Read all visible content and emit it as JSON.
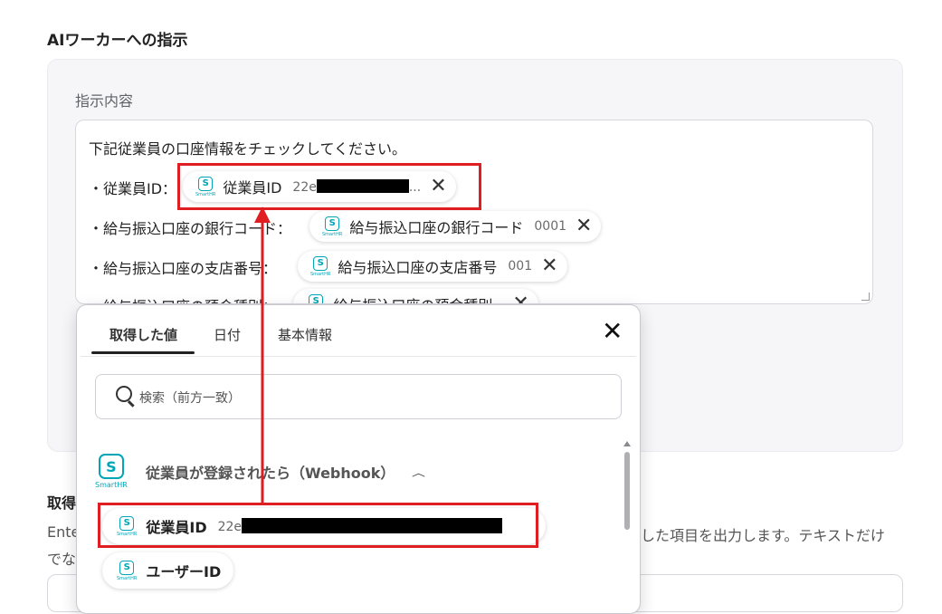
{
  "section_title": "AIワーカーへの指示",
  "field_label": "指示内容",
  "editor": {
    "line1": "下記従業員の口座情報をチェックしてください。",
    "line2_prefix": "・従業員ID：",
    "line3_prefix": "・給与振込口座の銀行コード：",
    "line4_prefix": "・給与振込口座の支店番号：",
    "line5_prefix": "・給与振込口座の預金種別：",
    "chips": [
      {
        "label": "従業員ID",
        "value": "22e",
        "suffix": "..."
      },
      {
        "label": "給与振込口座の銀行コード",
        "value": "0001"
      },
      {
        "label": "給与振込口座の支店番号",
        "value": "001"
      },
      {
        "label": "給与振込口座の預金種別",
        "value": ""
      }
    ],
    "close_glyph": "✕"
  },
  "background": {
    "title_partial": "取得",
    "text1_partial": "Ente",
    "text2_partial": "でな",
    "text3_partial": "した項目を出力します。テキストだけ"
  },
  "popup": {
    "tabs": [
      "取得した値",
      "日付",
      "基本情報"
    ],
    "active_tab": "取得した値",
    "close_glyph": "✕",
    "search_placeholder": "検索（前方一致）",
    "group_title": "従業員が登録されたら（Webhook）",
    "group_chevron": "︿",
    "items": [
      {
        "label": "従業員ID",
        "value": "22e"
      },
      {
        "label": "ユーザーID",
        "value": ""
      }
    ]
  },
  "logo": {
    "glyph": "S",
    "text": "SmartHR"
  },
  "colors": {
    "highlight": "#e01e22",
    "brand": "#00a6b8"
  }
}
